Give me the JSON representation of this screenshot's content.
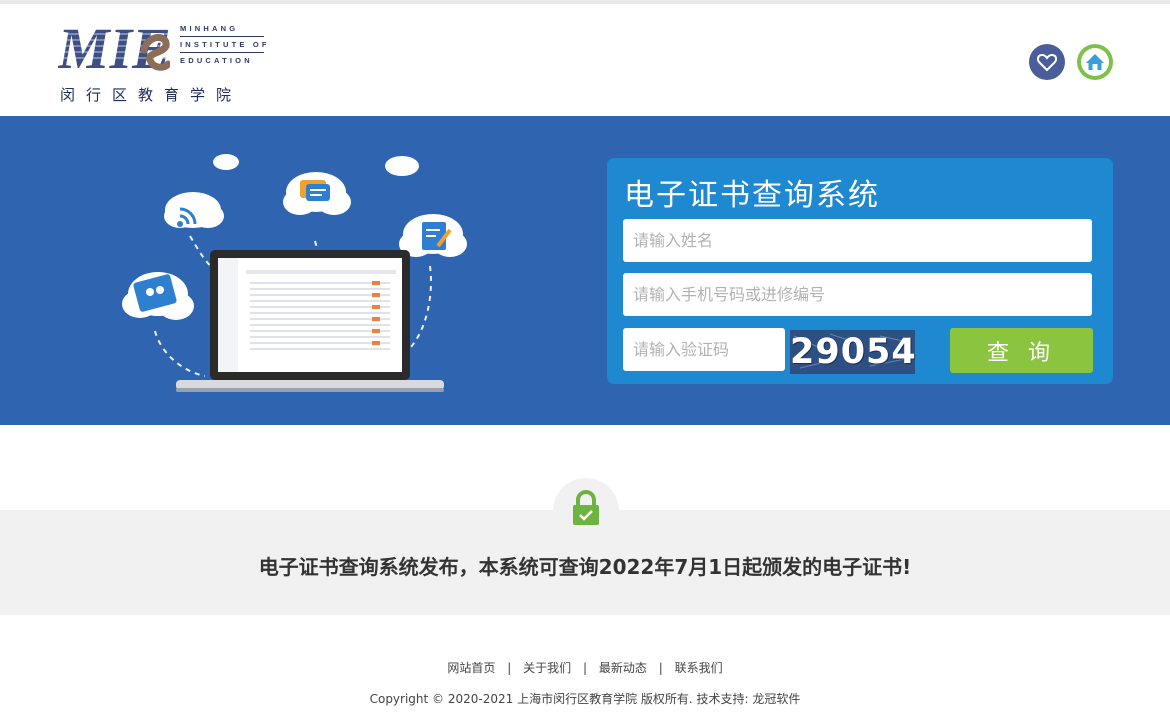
{
  "header": {
    "logo_letters": "MIE",
    "logo_en_line1": "MINHANG",
    "logo_en_line2": "INSTITUTE OF",
    "logo_en_line3": "EDUCATION",
    "logo_cn": "闵行区教育学院",
    "icons": [
      "heart-icon",
      "home-icon"
    ],
    "colors": {
      "favorite": "#4a5f9a",
      "home": "#7cc24a"
    }
  },
  "hero": {
    "background": "#2f65b0",
    "card_color": "#1e88d0",
    "title": "电子证书查询系统",
    "name_placeholder": "请输入姓名",
    "phone_placeholder": "请输入手机号码或进修编号",
    "code_placeholder": "请输入验证码",
    "captcha": "29054",
    "query_label": "查 询",
    "query_color": "#8bc53f",
    "illustration_icons": [
      "wifi-icon",
      "chat-icon",
      "edit-icon",
      "video-icon",
      "laptop-icon",
      "cloud-icon"
    ]
  },
  "notice": {
    "icon": "lock-icon",
    "text": "电子证书查询系统发布，本系统可查询2022年7月1日起颁发的电子证书!"
  },
  "footer": {
    "nav": [
      "网站首页",
      "关于我们",
      "最新动态",
      "联系我们"
    ],
    "separator": "|",
    "copyright": "Copyright © 2020-2021 上海市闵行区教育学院 版权所有. 技术支持: 龙冠软件"
  }
}
